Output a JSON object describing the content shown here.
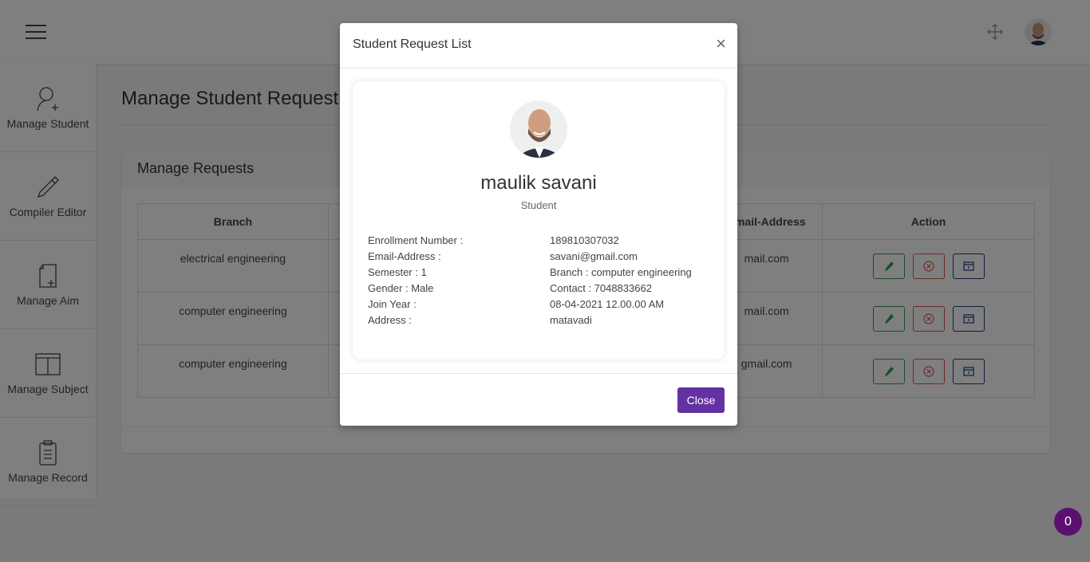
{
  "topbar": {
    "menu_icon": "hamburger-icon",
    "expand_icon": "expand-arrows-icon",
    "avatar_icon": "user-avatar"
  },
  "sidebar": {
    "items": [
      {
        "label": "Manage Student",
        "icon": "user-add-icon"
      },
      {
        "label": "Compiler Editor",
        "icon": "pencil-icon"
      },
      {
        "label": "Manage Aim",
        "icon": "file-add-icon"
      },
      {
        "label": "Manage Subject",
        "icon": "columns-icon"
      },
      {
        "label": "Manage Record",
        "icon": "clipboard-icon"
      }
    ]
  },
  "main": {
    "title": "Manage Student Request",
    "card_title": "Manage Requests",
    "table": {
      "headers": [
        "Branch",
        "",
        "",
        "Email-Address",
        "Action"
      ],
      "rows": [
        {
          "branch": "electrical engineering",
          "email": "mail.com"
        },
        {
          "branch": "computer engineering",
          "email": "mail.com"
        },
        {
          "branch": "computer engineering",
          "email": "gmail.com"
        }
      ]
    }
  },
  "modal": {
    "title": "Student Request List",
    "close_symbol": "×",
    "name": "maulik savani",
    "role": "Student",
    "details": {
      "enrollment_label": "Enrollment Number :",
      "enrollment_value": "189810307032",
      "email_label": "Email-Address :",
      "email_value": "savani@gmail.com",
      "semester": "Semester : 1",
      "branch": "Branch : computer engineering",
      "gender": "Gender : Male",
      "contact": "Contact : 7048833662",
      "join_label": "Join Year :",
      "join_value": "08-04-2021 12.00.00 AM",
      "address_label": "Address :",
      "address_value": "matavadi"
    },
    "close_button": "Close"
  },
  "badge": {
    "count": "0"
  },
  "colors": {
    "accent": "#6331a1",
    "badge": "#5b1070",
    "edit": "#2e9e4f",
    "delete": "#d9534f",
    "view": "#1f3f7a"
  }
}
